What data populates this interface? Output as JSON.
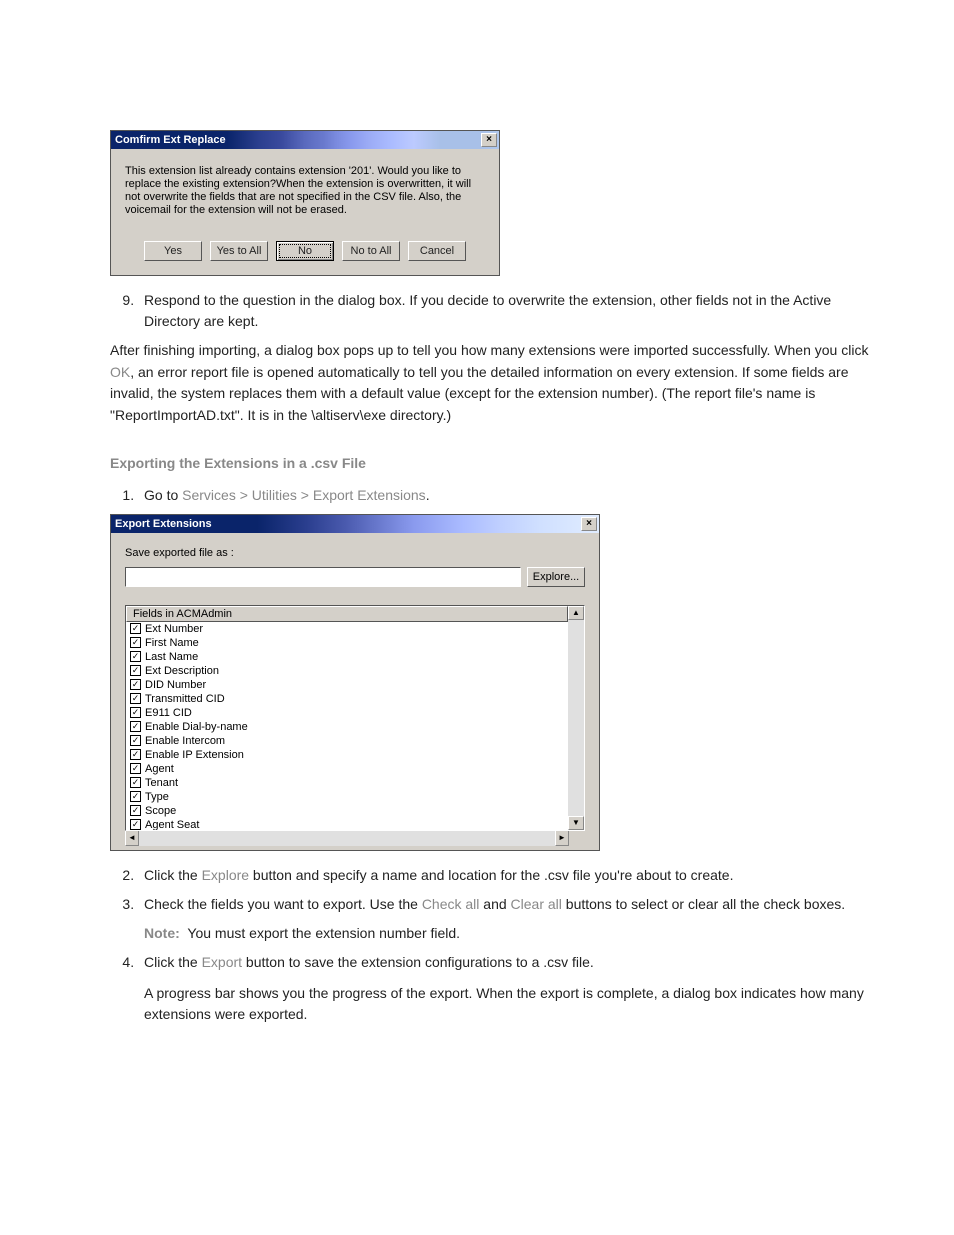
{
  "confirm_dialog": {
    "title": "Comfirm Ext Replace",
    "message": "This extension list already contains extension '201'. Would you like to replace the existing extension?When the extension is overwritten, it will not overwrite the fields that are not specified in the CSV file. Also, the voicemail for the extension will not be erased.",
    "buttons": {
      "yes": "Yes",
      "yes_all": "Yes to All",
      "no": "No",
      "no_all": "No to All",
      "cancel": "Cancel"
    },
    "close_glyph": "×"
  },
  "step9_text": "Respond to the question in the dialog box. If you decide to overwrite the extension, other fields not in the Active Directory are kept.",
  "para_after_import": "After finishing importing, a dialog box pops up to tell you how many extensions were imported successfully. When you click ",
  "para_after_import_ref": "OK",
  "para_after_import_tail": ", an error report file is opened automatically to tell you the detailed information on every extension. If some fields are invalid, the system replaces them with a default value (except for the extension number). (The report file's name is \"ReportImportAD.txt\". It is in the \\altiserv\\exe directory.)",
  "section_title": "Exporting the Extensions in a .csv File",
  "step1_pre": "Go to ",
  "step1_ref": "Services > Utilities > Export Extensions",
  "step1_post": ".",
  "export_dialog": {
    "title": "Export Extensions",
    "save_label": "Save exported file as :",
    "explore_label": "Explore...",
    "list_header": "Fields in ACMAdmin",
    "close_glyph": "×",
    "up_glyph": "▲",
    "down_glyph": "▼",
    "left_glyph": "◄",
    "right_glyph": "►",
    "items": [
      "Ext Number",
      "First Name",
      "Last Name",
      "Ext Description",
      "DID Number",
      "Transmitted CID",
      "E911 CID",
      "Enable Dial-by-name",
      "Enable Intercom",
      "Enable IP Extension",
      "Agent",
      "Tenant",
      "Type",
      "Scope",
      "Agent Seat"
    ],
    "check_glyph": "✓"
  },
  "step2_pre": "Click the ",
  "step2_ref": "Explore",
  "step2_post": " button and specify a name and location for the .csv file you're about to create.",
  "step3_pre": "Check the fields you want to export. Use the ",
  "step3_ref1": "Check all",
  "step3_mid": " and ",
  "step3_ref2": "Clear all",
  "step3_post": " buttons to select or clear all the check boxes.",
  "note_label": "Note:",
  "note_text": "You must export the extension number field.",
  "step4_pre": "Click the ",
  "step4_ref": "Export",
  "step4_post": " button to save the extension configurations to a .csv file.",
  "step4_para": "A progress bar shows you the progress of the export. When the export is complete, a dialog box indicates how many extensions were exported."
}
